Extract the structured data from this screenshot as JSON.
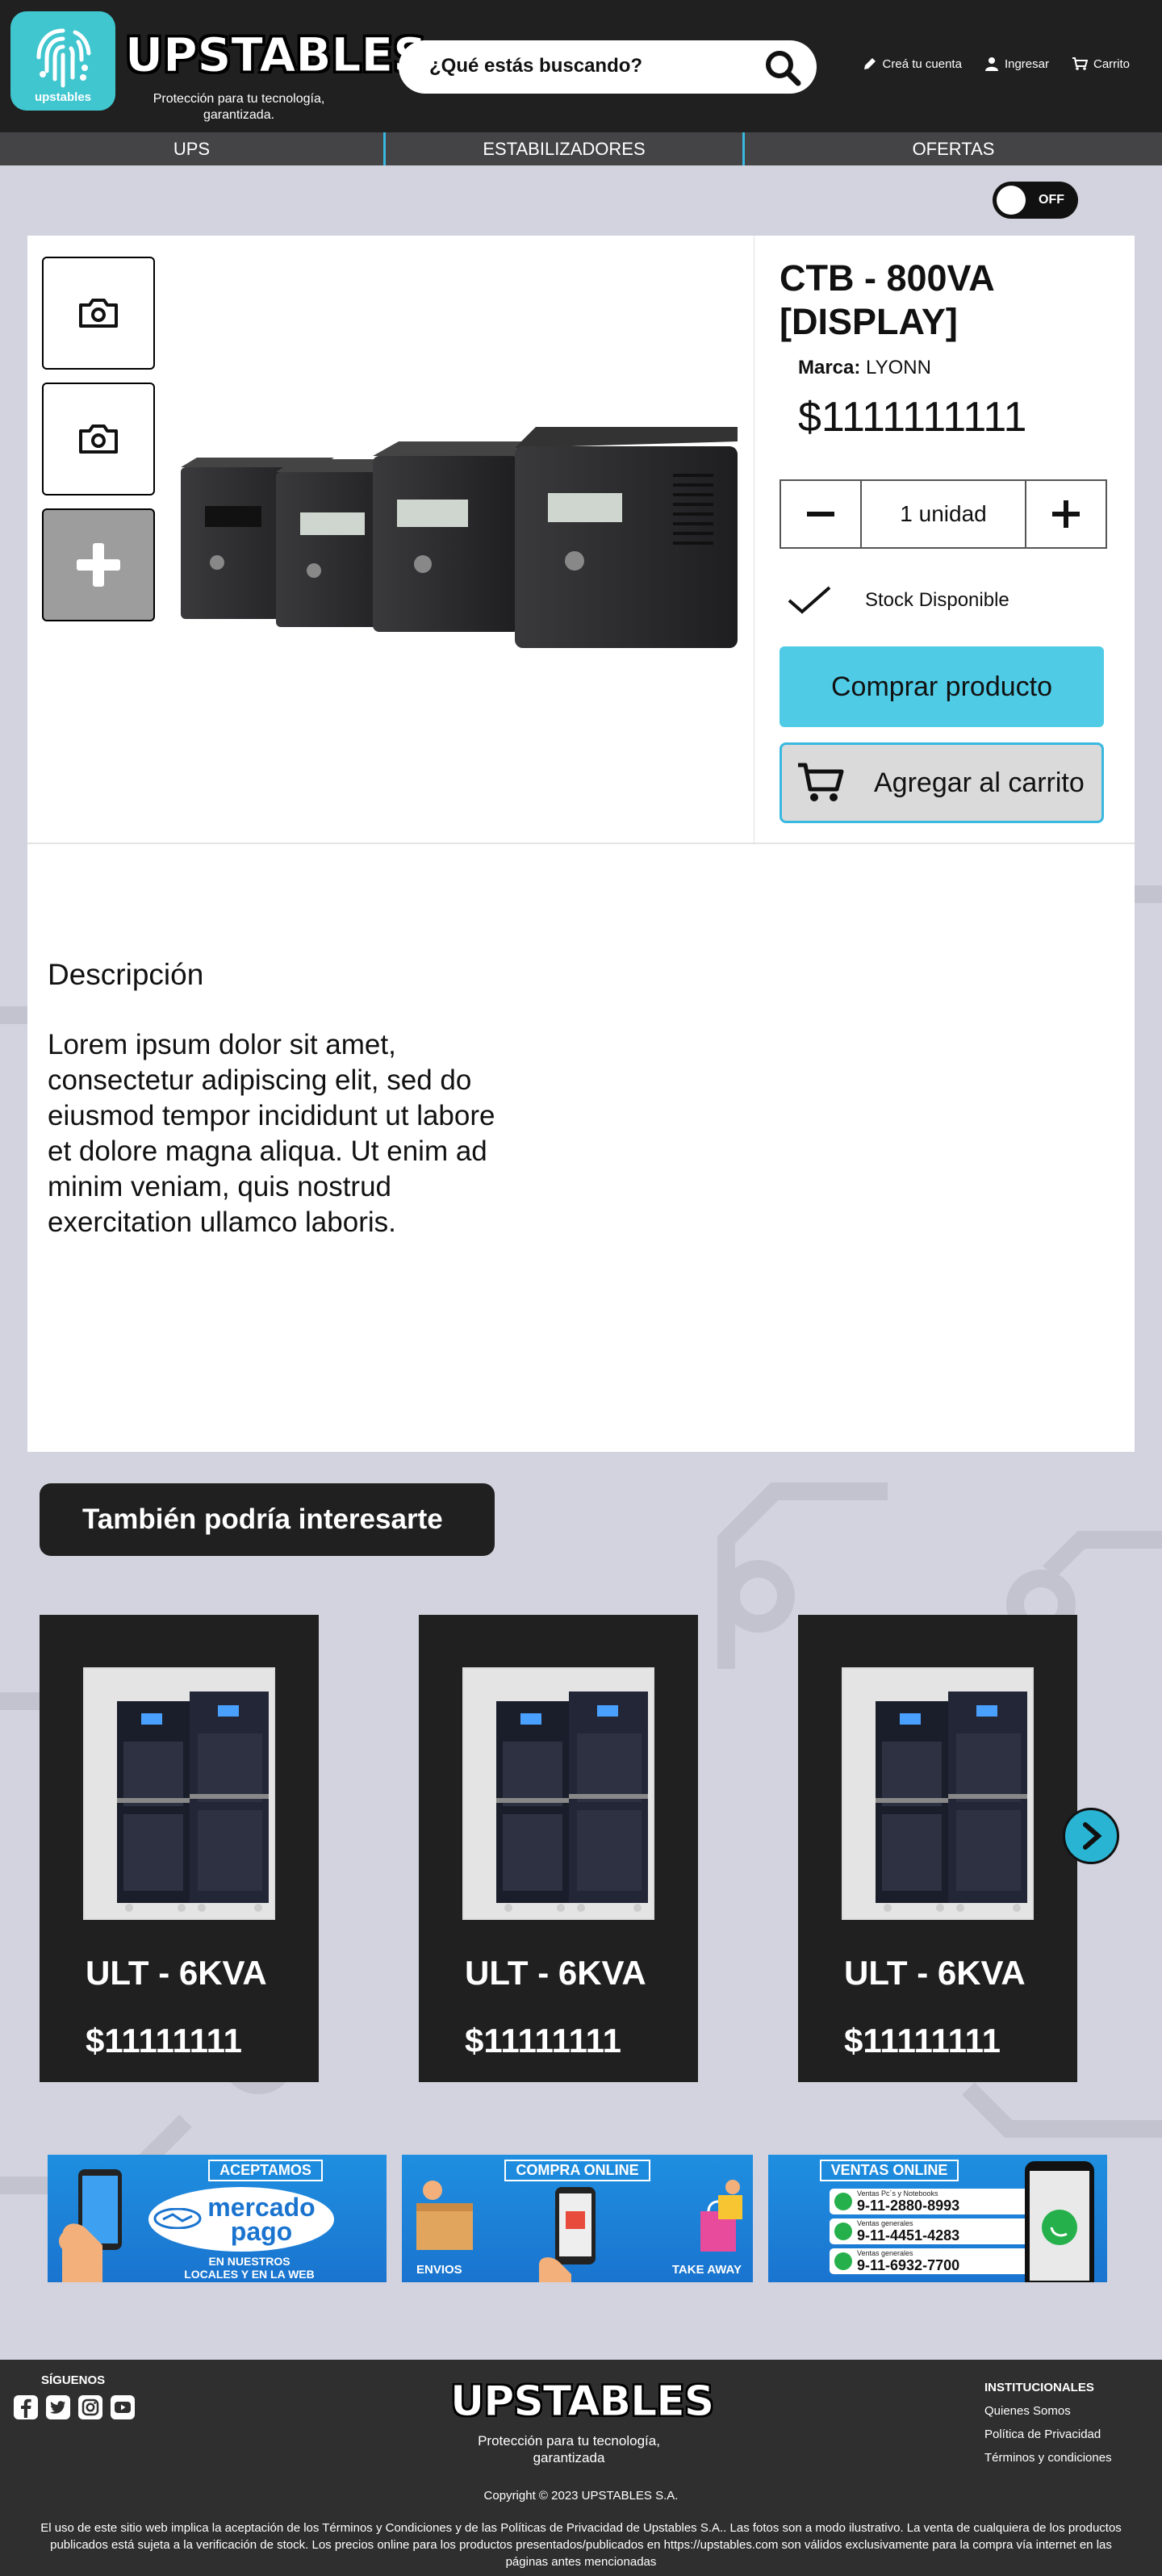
{
  "header": {
    "logo_sub": "upstables",
    "brand": "UPSTABLES",
    "tagline": "Protección para tu tecnología, garantizada.",
    "search_placeholder": "¿Qué estás buscando?",
    "links": [
      {
        "icon": "pencil-icon",
        "label": "Creá tu cuenta"
      },
      {
        "icon": "user-icon",
        "label": "Ingresar"
      },
      {
        "icon": "cart-icon",
        "label": "Carrito"
      }
    ]
  },
  "nav": {
    "items": [
      "UPS",
      "ESTABILIZADORES",
      "OFERTAS"
    ],
    "accent": "#39b8e0"
  },
  "toggle": {
    "label": "OFF"
  },
  "product": {
    "title": "CTB - 800VA [DISPLAY]",
    "brand_label": "Marca:",
    "brand_value": "LYONN",
    "price": "$1111111111",
    "quantity": "1 unidad",
    "stock": "Stock Disponible",
    "buy_label": "Comprar producto",
    "cart_label": "Agregar al carrito",
    "buy_color": "#4fcbe6"
  },
  "description": {
    "title": "Descripción",
    "body": "Lorem ipsum dolor sit amet, consectetur adipiscing elit, sed do eiusmod tempor incididunt ut labore et dolore magna aliqua. Ut enim ad minim veniam, quis nostrud exercitation ullamco laboris."
  },
  "recommendations": {
    "title": "También podría interesarte",
    "cards": [
      {
        "name": "ULT - 6KVA",
        "price": "$11111111"
      },
      {
        "name": "ULT - 6KVA",
        "price": "$11111111"
      },
      {
        "name": "ULT - 6KVA",
        "price": "$11111111"
      }
    ]
  },
  "banners": {
    "accept": {
      "head": "ACEPTAMOS",
      "brand": "mercado pago",
      "line1": "EN NUESTROS",
      "line2": "LOCALES Y EN LA WEB"
    },
    "online": {
      "head": "COMPRA ONLINE",
      "left": "ENVIOS",
      "right": "TAKE AWAY"
    },
    "sales": {
      "head": "VENTAS ONLINE",
      "phones": [
        {
          "label": "Ventas Pc´s y Notebooks",
          "number": "9-11-2880-8993"
        },
        {
          "label": "Ventas generales",
          "number": "9-11-4451-4283"
        },
        {
          "label": "Ventas generales",
          "number": "9-11-6932-7700"
        }
      ]
    }
  },
  "footer": {
    "follow": "SÍGUENOS",
    "social": [
      "facebook-icon",
      "twitter-icon",
      "instagram-icon",
      "youtube-icon"
    ],
    "brand": "UPSTABLES",
    "tagline": "Protección para tu tecnología, garantizada",
    "inst_title": "INSTITUCIONALES",
    "inst_links": [
      "Quienes Somos",
      "Política de Privacidad",
      "Términos y condiciones"
    ],
    "copyright": "Copyright © 2023 UPSTABLES S.A.",
    "legal": "El uso de este sitio web implica la aceptación de los Términos y Condiciones y de las Políticas de Privacidad de Upstables S.A.. Las fotos son a modo ilustrativo. La venta de cualquiera de los productos publicados está sujeta a la verificación de stock. Los precios online para los productos presentados/publicados en https://upstables.com  son válidos exclusivamente para la compra vía internet en las páginas antes mencionadas"
  }
}
